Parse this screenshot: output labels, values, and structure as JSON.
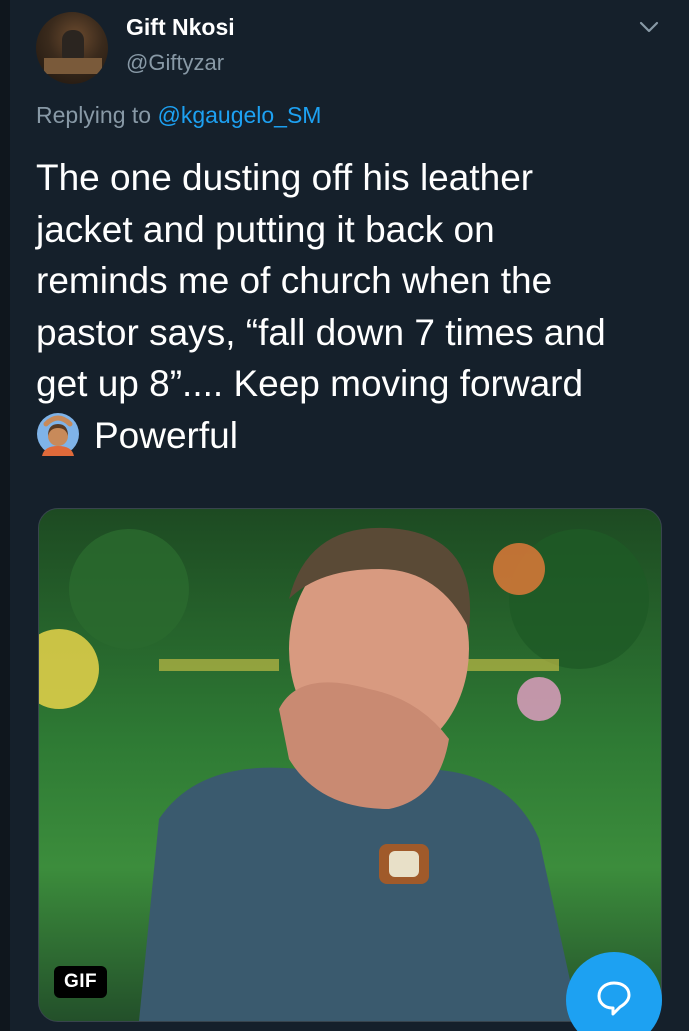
{
  "user": {
    "display_name": "Gift Nkosi",
    "handle": "@Giftyzar"
  },
  "reply": {
    "prefix": "Replying to",
    "mention": "@kgaugelo_SM"
  },
  "tweet": {
    "lines": [
      "The one dusting off his leather",
      "jacket and putting it back on",
      "reminds me of church when the",
      "pastor says, “fall down 7 times and",
      "get up 8”.... Keep moving forward",
      "Powerful"
    ],
    "emoji": "person-gesturing-ok-emoji"
  },
  "media": {
    "badge": "GIF",
    "description_icon": "gif-image"
  },
  "compose": {
    "icon": "reply-bubble-icon"
  },
  "colors": {
    "background": "#15202b",
    "secondary_text": "#8899a6",
    "accent": "#1da1f2"
  }
}
